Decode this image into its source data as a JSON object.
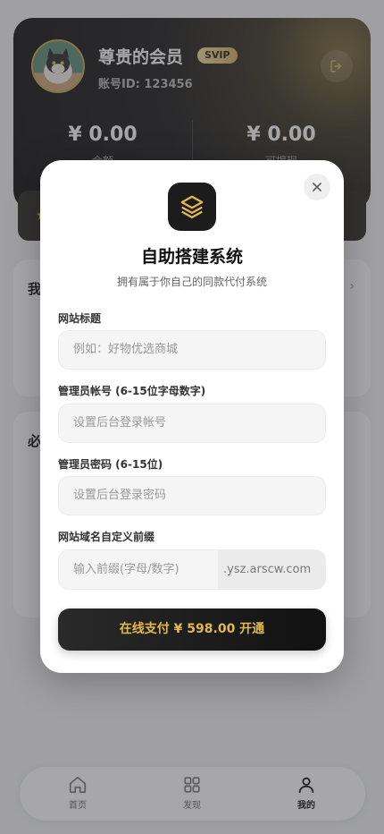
{
  "profile": {
    "name": "尊贵的会员",
    "badge": "SVIP",
    "account_id": "账号ID: 123456",
    "stats": [
      {
        "value": "¥ 0.00",
        "label": "余额"
      },
      {
        "value": "¥ 0.00",
        "label": "可提现"
      }
    ]
  },
  "sections": [
    {
      "title": "我"
    },
    {
      "title": "必"
    }
  ],
  "bottom_nav": [
    {
      "label": "首页",
      "icon": "home-icon",
      "active": false
    },
    {
      "label": "发现",
      "icon": "grid-icon",
      "active": false
    },
    {
      "label": "我的",
      "icon": "user-icon",
      "active": true
    }
  ],
  "modal": {
    "title": "自助搭建系统",
    "subtitle": "拥有属于你自己的同款代付系统",
    "fields": [
      {
        "label": "网站标题",
        "placeholder": "例如：好物优选商城"
      },
      {
        "label": "管理员帐号 (6-15位字母数字)",
        "placeholder": "设置后台登录帐号"
      },
      {
        "label": "管理员密码 (6-15位)",
        "placeholder": "设置后台登录密码"
      }
    ],
    "domain": {
      "label": "网站域名自定义前缀",
      "placeholder": "输入前缀(字母/数字)",
      "suffix": ".ysz.arscw.com"
    },
    "pay_button": "在线支付 ¥ 598.00 开通"
  },
  "colors": {
    "accent_gold": "#e3b84e",
    "dark": "#1c1c1c"
  }
}
